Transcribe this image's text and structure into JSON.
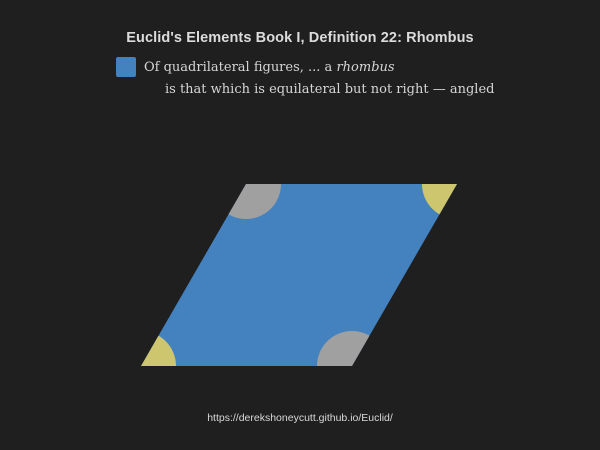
{
  "page": {
    "title": "Euclid's Elements Book I, Definition 22: Rhombus",
    "footer_url": "https://derekshoneycutt.github.io/Euclid/"
  },
  "definition": {
    "line1_prefix": "Of quadrilateral figures, ... a ",
    "term": "rhombus",
    "line2": "is that which is equilateral but not right — angled"
  },
  "colors": {
    "background": "#1f1f1f",
    "rhombus_fill": "#4481bf",
    "obtuse_angle_marker": "#a0a0a0",
    "acute_angle_marker": "#cdc66f",
    "text": "#d6d6d6"
  },
  "figure": {
    "shape": "rhombus",
    "angle_markers": [
      {
        "vertex": "top-left",
        "kind": "obtuse",
        "icon": "gray-sector"
      },
      {
        "vertex": "top-right",
        "kind": "acute",
        "icon": "yellow-sector"
      },
      {
        "vertex": "bottom-right",
        "kind": "obtuse",
        "icon": "gray-sector"
      },
      {
        "vertex": "bottom-left",
        "kind": "acute",
        "icon": "yellow-sector"
      }
    ]
  }
}
